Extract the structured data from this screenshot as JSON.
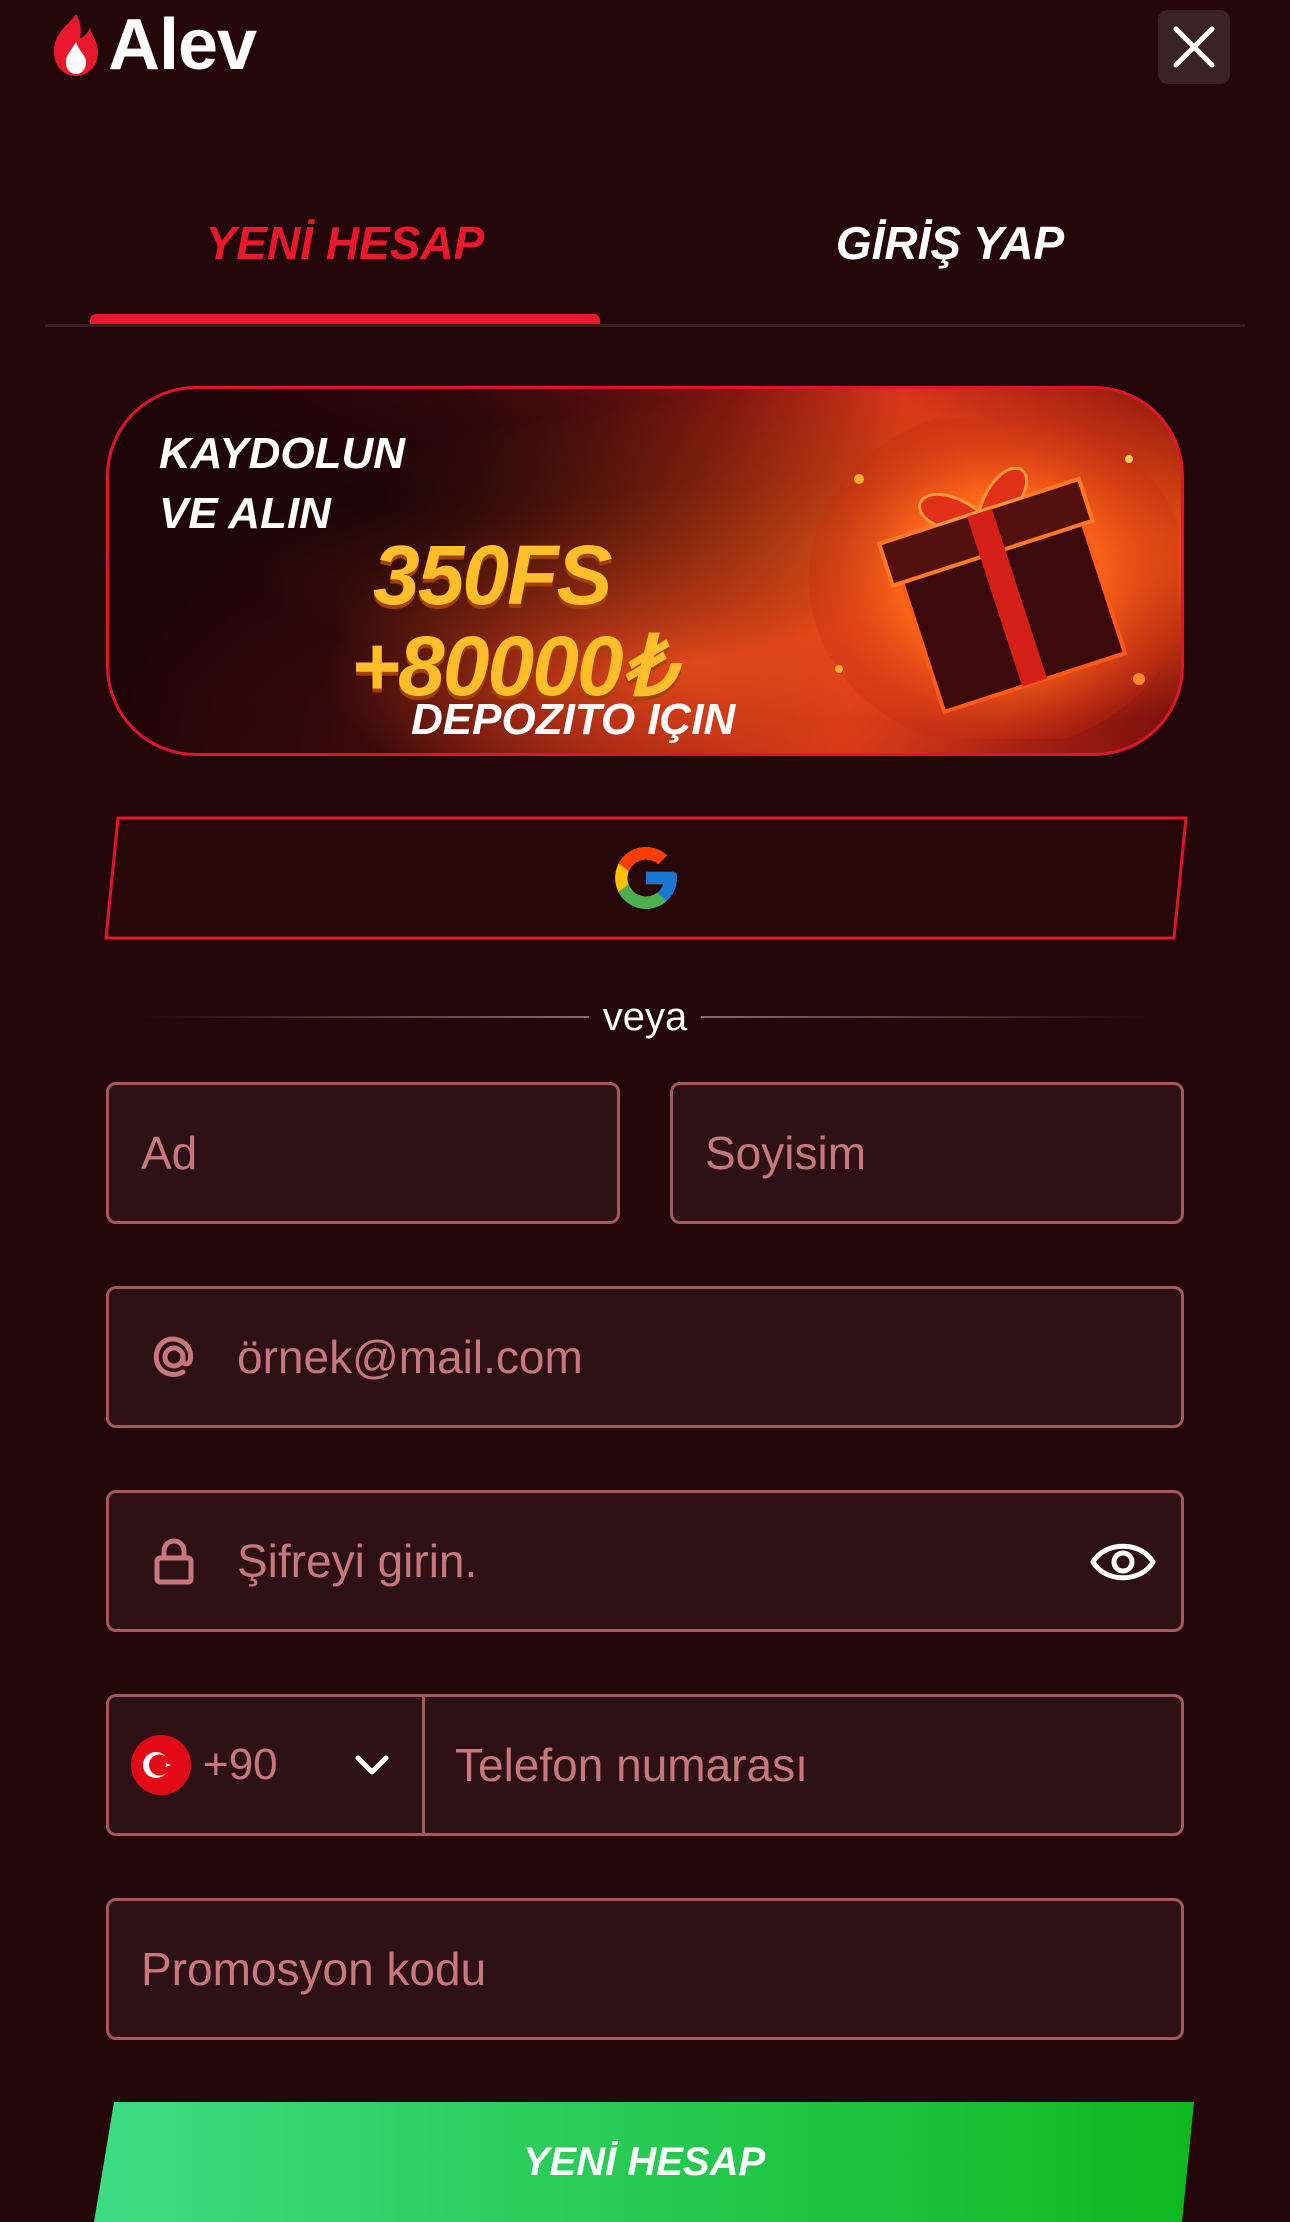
{
  "header": {
    "logo_text": "Alev",
    "close_icon": "close-icon"
  },
  "tabs": [
    {
      "label": "YENİ HESAP",
      "active": true
    },
    {
      "label": "GİRİŞ YAP",
      "active": false
    }
  ],
  "banner": {
    "line1": "KAYDOLUN",
    "line2": "VE ALIN",
    "line3": "350FS",
    "line4": "+80000₺",
    "line5": "DEPOZITO IÇIN"
  },
  "social": {
    "google_icon": "google-icon"
  },
  "divider": {
    "text": "veya"
  },
  "form": {
    "first_name": {
      "placeholder": "Ad"
    },
    "last_name": {
      "placeholder": "Soyisim"
    },
    "email": {
      "placeholder": "örnek@mail.com",
      "icon": "at-icon"
    },
    "password": {
      "placeholder": "Şifreyi girin.",
      "icon": "lock-icon",
      "toggle_icon": "eye-icon"
    },
    "phone": {
      "country_code": "+90",
      "flag": "turkey-flag-icon",
      "placeholder": "Telefon numarası"
    },
    "promo": {
      "placeholder": "Promosyon kodu"
    }
  },
  "submit": {
    "label": "YENİ HESAP"
  },
  "colors": {
    "background": "#240709",
    "accent_red": "#e8192c",
    "field_border": "#a35a5f",
    "placeholder": "#c7787e",
    "submit_green_start": "#3ddc84",
    "submit_green_end": "#10b820"
  }
}
